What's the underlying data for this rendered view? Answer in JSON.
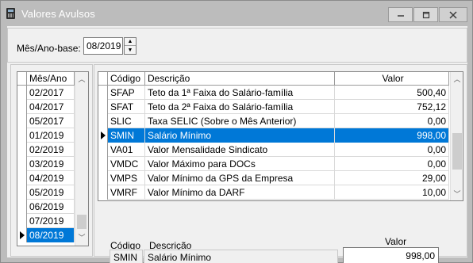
{
  "window": {
    "title": "Valores Avulsos"
  },
  "period": {
    "label": "Mês/Ano-base:",
    "value": "08/2019"
  },
  "months": {
    "header": "Mês/Ano",
    "items": [
      "02/2017",
      "04/2017",
      "05/2017",
      "01/2019",
      "02/2019",
      "03/2019",
      "04/2019",
      "05/2019",
      "06/2019",
      "07/2019",
      "08/2019"
    ],
    "selected": "08/2019"
  },
  "values": {
    "headers": {
      "code": "Código",
      "description": "Descrição",
      "value": "Valor"
    },
    "rows": [
      {
        "code": "SFAP",
        "description": "Teto da 1ª Faixa do Salário-família",
        "value": "500,40"
      },
      {
        "code": "SFAT",
        "description": "Teto da 2ª Faixa do Salário-família",
        "value": "752,12"
      },
      {
        "code": "SLIC",
        "description": "Taxa SELIC (Sobre o Mês Anterior)",
        "value": "0,00"
      },
      {
        "code": "SMIN",
        "description": "Salário Mínimo",
        "value": "998,00",
        "selected": true
      },
      {
        "code": "VA01",
        "description": "Valor Mensalidade Sindicato",
        "value": "0,00"
      },
      {
        "code": "VMDC",
        "description": "Valor Máximo para DOCs",
        "value": "0,00"
      },
      {
        "code": "VMPS",
        "description": "Valor Mínimo da GPS da Empresa",
        "value": "29,00"
      },
      {
        "code": "VMRF",
        "description": "Valor Mínimo da DARF",
        "value": "10,00"
      }
    ]
  },
  "detail": {
    "code_label": "Código",
    "description_label": "Descrição",
    "value_label": "Valor",
    "code": "SMIN",
    "description": "Salário Mínimo",
    "value": "998,00"
  }
}
